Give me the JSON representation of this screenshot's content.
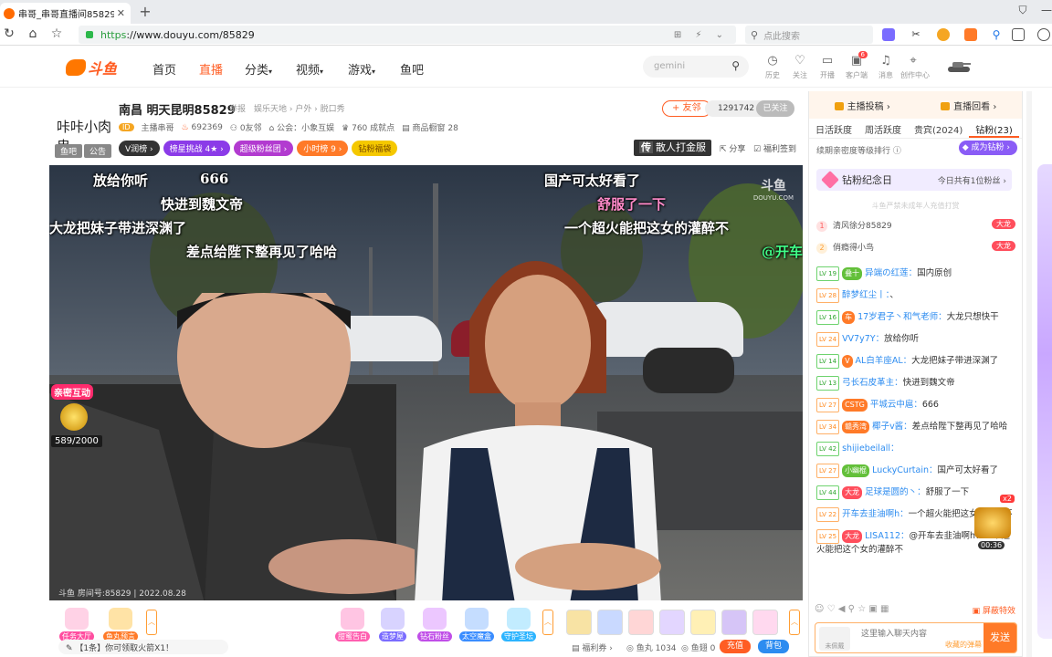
{
  "browser": {
    "tab_title": "串哥_串哥直播间85829_斗鱼",
    "url_prefix": "https",
    "url_rest": "://www.douyu.com/85829",
    "search_placeholder": "点此搜索"
  },
  "site": {
    "logo_text": "斗鱼",
    "nav": [
      {
        "label": "首页",
        "active": false
      },
      {
        "label": "直播",
        "active": true
      },
      {
        "label": "分类",
        "caret": true
      },
      {
        "label": "视频",
        "caret": true
      },
      {
        "label": "游戏",
        "caret": true
      },
      {
        "label": "鱼吧",
        "active": false
      }
    ],
    "search_value": "gemini",
    "header_icons": [
      {
        "name": "history-icon",
        "label": "历史"
      },
      {
        "name": "follow-icon",
        "label": "关注"
      },
      {
        "name": "broadcast-icon",
        "label": "开播"
      },
      {
        "name": "client-icon",
        "label": "客户端",
        "badge": "6"
      },
      {
        "name": "message-icon",
        "label": "消息"
      },
      {
        "name": "creator-icon",
        "label": "创作中心"
      }
    ]
  },
  "room": {
    "avatar_text": "咔咔小肉串",
    "tags": [
      "鱼吧",
      "公告"
    ],
    "title": "南昌 明天昆明85829",
    "report": "举报",
    "category": "娱乐天地 › 户外 › 脱口秀",
    "anchor_level": "ID",
    "anchor_name": "主播串哥",
    "heat": "692369",
    "friends": "0友邻",
    "guild": "公会：小象互娱",
    "achievements": "760 成就点",
    "items": "商品橱窗 28",
    "badges": [
      {
        "label": "V润榜",
        "color": "#333333"
      },
      {
        "label": "榜星挑战 4★",
        "color": "#8b3be8"
      },
      {
        "label": "超级粉丝团",
        "color": "#b23bd0"
      },
      {
        "label": "小时榜 9",
        "color": "#ff7a28"
      },
      {
        "label": "钻粉福袋",
        "color": "#f5c800"
      }
    ],
    "follow_btn": "+ 友邻",
    "follow_count": "1291742",
    "followed": "已关注",
    "gift_btn_prefix": "传",
    "gift_btn": "散人打金服",
    "share": "分享",
    "checkin": "福利签到"
  },
  "video": {
    "danmu": [
      {
        "text": "放给你听",
        "style": ""
      },
      {
        "text": "666",
        "style": ""
      },
      {
        "text": "快进到魏文帝",
        "style": ""
      },
      {
        "text": "大龙把妹子带进深渊了",
        "style": ""
      },
      {
        "text": "差点给陛下整再见了哈哈",
        "style": ""
      },
      {
        "text": "国产可太好看了",
        "style": ""
      },
      {
        "text": "舒服了一下",
        "style": "pink"
      },
      {
        "text": "一个超火能把这女的灌醉不",
        "style": ""
      },
      {
        "text": "@开车",
        "style": "green"
      }
    ],
    "watermark": "斗鱼",
    "watermark_small": "DOUYU.COM",
    "footer": "斗鱼 房间号:85829 | 2022.08.28",
    "interact_label": "亲密互动",
    "interact_count": "589/2000"
  },
  "bottom": {
    "left_icons": [
      {
        "name": "task-hall-icon",
        "label": "任务大厅",
        "color": "#ff4ea0"
      },
      {
        "name": "fishball-icon",
        "label": "鱼丸预言",
        "color": "#ff7a28"
      }
    ],
    "mid_icons": [
      {
        "name": "sweet-confess-icon",
        "label": "甜蜜告白",
        "color": "#ff5fb0"
      },
      {
        "name": "dream-house-icon",
        "label": "造梦屋",
        "color": "#7a6cff"
      },
      {
        "name": "diamond-fan-icon",
        "label": "钻石粉丝",
        "color": "#c04ee8"
      },
      {
        "name": "space-box-icon",
        "label": "太空魔盒",
        "color": "#3a8dff"
      },
      {
        "name": "guardian-icon",
        "label": "守护圣坛",
        "color": "#2cb4ff"
      }
    ],
    "notice": "【1条】你可领取火箭X1！",
    "welfare": "福利券",
    "fishball": "鱼丸 1034",
    "fishball_label": "鱼丸",
    "fishball_count": "1034",
    "fishball_ext": "鱼翅 0",
    "recharge": "充值",
    "backpack": "背包"
  },
  "panel": {
    "top_links": [
      "主播投稿 ›",
      "直播回看 ›"
    ],
    "tabs": [
      "日活跃度",
      "周活跃度",
      "贵宾(2024)",
      "钻粉(23)"
    ],
    "rank_hint": "续期亲密度等级排行",
    "become_fan": "成为钻粉",
    "fan_day": "钻粉纪念日",
    "fan_day_right": "今日共有1位粉丝",
    "minor_hint": "斗鱼严禁未成年人充值打赏",
    "rank": [
      {
        "no": "1",
        "name": "清风徐分85829",
        "badge": "大龙"
      },
      {
        "no": "2",
        "name": "俏瘾得小鸟",
        "badge": "大龙"
      }
    ],
    "chat": [
      {
        "lv": "LV 19",
        "medal": "叠十",
        "user": "异端の红莲：",
        "text": "国内原创"
      },
      {
        "lv": "LV 28",
        "medal": "",
        "user": "醉梦红尘丨：",
        "text": "、"
      },
      {
        "lv": "LV 16",
        "medal": "车",
        "user": "17岁君子丶和气老师：",
        "text": "大龙只想快干"
      },
      {
        "lv": "LV 24",
        "medal": "",
        "user": "VV7y7Y：",
        "text": "放给你听"
      },
      {
        "lv": "LV 14",
        "medal": "V",
        "user": "AL白羊座AL：",
        "text": "大龙把妹子带进深渊了"
      },
      {
        "lv": "LV 13",
        "medal": "",
        "user": "弓长石皮革主：",
        "text": "快进到魏文帝"
      },
      {
        "lv": "LV 27",
        "medal": "CSTG",
        "user": "平城云中扈：",
        "text": "666"
      },
      {
        "lv": "LV 34",
        "medal": "赣秀湾",
        "user": "椰子v酱：",
        "text": "差点给陛下整再见了哈哈"
      },
      {
        "lv": "LV 42",
        "medal": "",
        "user": "shijiebeilall：",
        "text": ""
      },
      {
        "lv": "LV 27",
        "medal": "小幽棍",
        "user": "LuckyCurtain：",
        "text": "国产可太好看了"
      },
      {
        "lv": "LV 44",
        "medal": "大龙",
        "user": "足球是圆的丶：",
        "text": "舒服了一下"
      },
      {
        "lv": "LV 22",
        "medal": "",
        "user": "开车去韭油啊h：",
        "text": "一个超火能把这女的灌醉不"
      },
      {
        "lv": "LV 25",
        "medal": "大龙",
        "user": "LISA112：",
        "text": "@开车去韭油啊h：一个超火能把这个女的灌醉不"
      }
    ],
    "chest_multiplier": "x2",
    "chest_timer": "00:36",
    "shield_label": "屏蔽特效",
    "input_avatar": "未佩戴",
    "input_placeholder": "这里输入聊天内容",
    "input_tip": "收藏的弹幕",
    "send": "发送"
  }
}
